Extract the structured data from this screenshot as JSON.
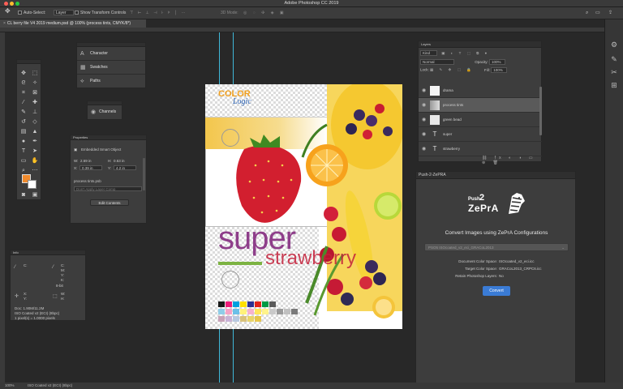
{
  "app": {
    "title": "Adobe Photoshop CC 2019",
    "doc_tab": "CL berry file V4 2019 medium.psd @ 100% (process tints, CMYK/8*)",
    "status_zoom": "100%",
    "status_profile": "ISO Coated v2 (ECI) (8bpc)"
  },
  "options": {
    "auto_select_label": "Auto-Select:",
    "auto_select_target": "Layer",
    "show_transform_label": "Show Transform Controls",
    "mode_label": "3D Mode:"
  },
  "mini_panels": {
    "character": "Character",
    "swatches": "Swatches",
    "paths": "Paths",
    "channels": "Channels"
  },
  "properties": {
    "title": "Properties",
    "kind": "Embedded Smart Object",
    "w_label": "W:",
    "w_value": "2.69 in",
    "h_label": "H:",
    "h_value": "0.63 in",
    "x_label": "X:",
    "x_value": "0.39 in",
    "y_label": "Y:",
    "y_value": "4.2 in",
    "filename": "process tints.psb",
    "comp_placeholder": "Don't Apply Layer Comp",
    "edit_button": "Edit Contents"
  },
  "info": {
    "title": "Info",
    "c_label": "C:",
    "m_label": "M:",
    "y_label": "Y:",
    "k_label": "K:",
    "bit_depth": "8-bit",
    "x_label": "X:",
    "y_coord_label": "Y:",
    "w_label": "W:",
    "h_label": "H:",
    "doc": "Doc: 1.90M/11.2M",
    "profile": "ISO Coated v2 (ECI) (8bpc)",
    "pixel": "1 pixel(s) = 1.0000 pixels"
  },
  "layers": {
    "title": "Layers",
    "filter": "Kind",
    "blend": "Normal",
    "opacity_label": "Opacity:",
    "opacity": "100%",
    "lock_label": "Lock:",
    "fill_label": "Fill:",
    "fill": "100%",
    "items": [
      {
        "name": "drama"
      },
      {
        "name": "process tints"
      },
      {
        "name": "green bead"
      },
      {
        "name": "super"
      },
      {
        "name": "strawberry"
      }
    ]
  },
  "push": {
    "title": "Push-2-ZePRA",
    "logo_small": "Push",
    "logo_main": "ZePrA",
    "heading": "Convert Images using ZePrA Configurations",
    "dropdown": "PSO5 ISOcoated_v2_eci_GRACoL2013",
    "doc_label": "Document Color Space:",
    "doc_value": "ISOcoated_v2_eci.icc",
    "target_label": "Target Color Space:",
    "target_value": "GRACoL2013_CRPC6.icc",
    "retain_label": "Retain Photoshop Layers:",
    "retain_value": "No",
    "button": "Convert"
  },
  "artwork": {
    "logo_top": "COLOR",
    "logo_bottom": "Logic",
    "word_super": "super",
    "word_strawberry": "strawberry"
  },
  "colors": {
    "accent_blue": "#3a7bd5",
    "guide": "#3fb8d8",
    "super_purple": "#8e3e8a",
    "strawberry_red": "#c4203a",
    "fg_swatch": "#f08a2c"
  }
}
